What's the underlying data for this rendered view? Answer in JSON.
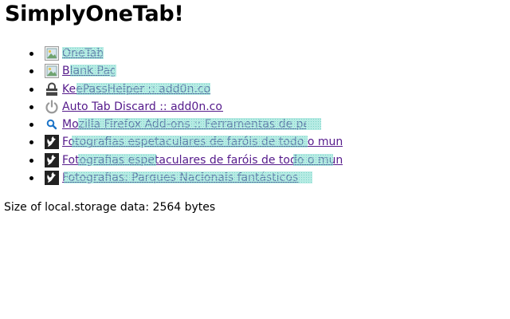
{
  "page": {
    "title": "SimplyOneTab!"
  },
  "tabs": [
    {
      "label": "OneTab",
      "icon": "broken-image-icon"
    },
    {
      "label": "Blank Page",
      "icon": "broken-image-icon"
    },
    {
      "label": "KeePassHelper :: add0n.com",
      "icon": "lock-icon"
    },
    {
      "label": "Auto Tab Discard :: add0n.com",
      "icon": "power-icon"
    },
    {
      "label": "Mozilla Firefox Add-ons :: Ferramentas de pesquisa",
      "icon": "magnifier-icon"
    },
    {
      "label": "Fotografias espetaculares de faróis de todo o mundo",
      "icon": "bird-tile-icon"
    },
    {
      "label": "Fotografias espetaculares de faróis de todo o mundo",
      "icon": "bird-tile-icon"
    },
    {
      "label": "Fotografias: Parques Nacionais fantásticos",
      "icon": "bird-tile-icon"
    }
  ],
  "footer": {
    "storage_text": "Size of local.storage data: 2564 bytes"
  },
  "colors": {
    "link": "#551a8b",
    "scribble": "#5fd0bf"
  }
}
